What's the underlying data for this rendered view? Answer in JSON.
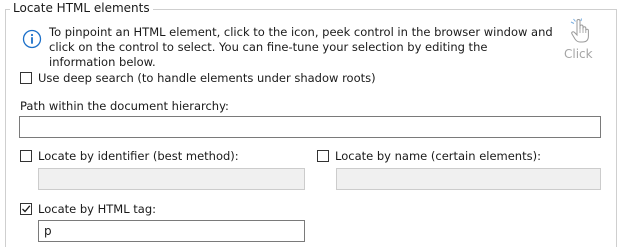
{
  "group": {
    "title": "Locate HTML elements"
  },
  "info": {
    "icon": "info-icon",
    "text": "To pinpoint an HTML element, click to the icon, peek control in the browser window and click on the control to select. You can fine-tune your selection by editing the information below."
  },
  "click_button": {
    "icon": "hand-pointer-icon",
    "label": "Click"
  },
  "deep_search": {
    "checked": false,
    "label": "Use deep search (to handle elements under shadow roots)"
  },
  "path": {
    "label": "Path within the document hierarchy:",
    "value": ""
  },
  "by_identifier": {
    "checked": false,
    "label": "Locate by identifier (best method):",
    "value": ""
  },
  "by_name": {
    "checked": false,
    "label": "Locate by name (certain elements):",
    "value": ""
  },
  "by_tag": {
    "checked": true,
    "label": "Locate by HTML tag:",
    "value": "p"
  },
  "colors": {
    "info_blue": "#1c70c9",
    "disabled_text": "#a5a5a5",
    "disabled_field": "#f0f0f0"
  }
}
